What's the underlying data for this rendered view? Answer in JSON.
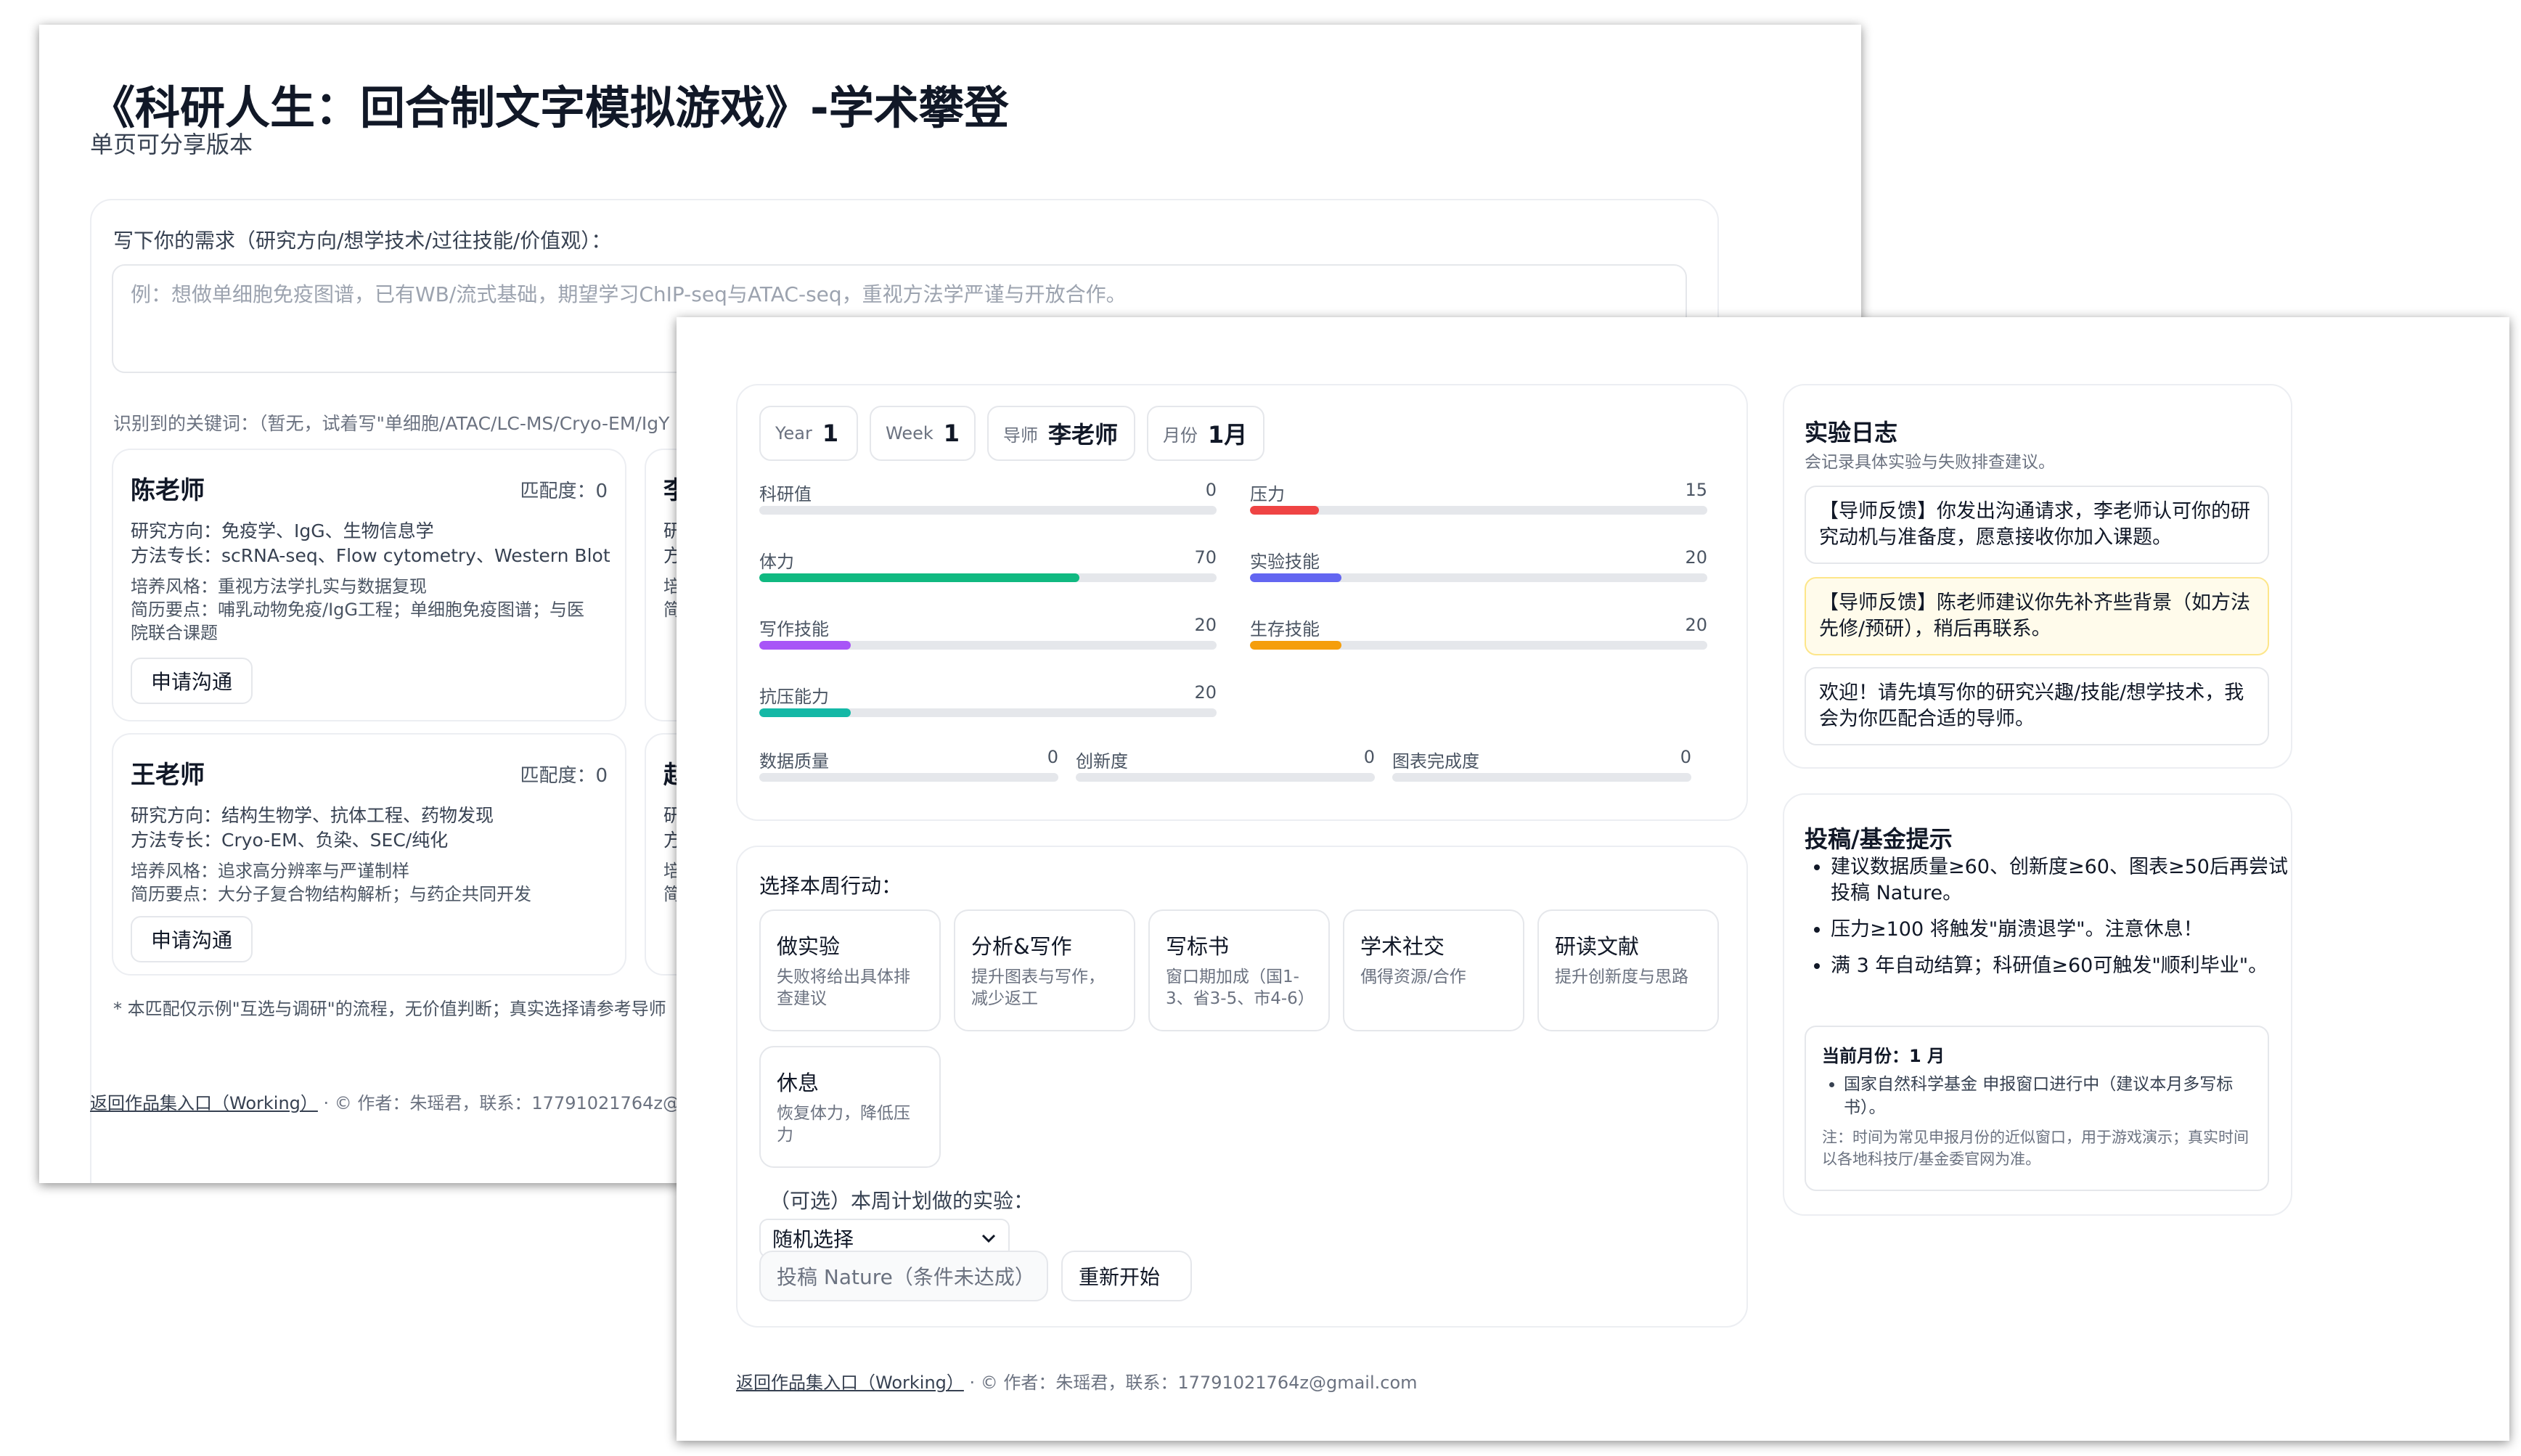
{
  "left_window": {
    "title": "《科研人生：回合制文字模拟游戏》-学术攀登",
    "subtitle": "单页可分享版本",
    "prompt_label": "写下你的需求（研究方向/想学技术/过往技能/价值观）：",
    "textarea_placeholder": "例：想做单细胞免疫图谱，已有WB/流式基础，期望学习ChIP-seq与ATAC-seq，重视方法学严谨与开放合作。",
    "keywords_line": "识别到的关键词：（暂无，试着写\"单细胞/ATAC/LC-MS/Cryo-EM/IgY",
    "mentors": [
      {
        "name": "陈老师",
        "match": "匹配度：0",
        "direction": "研究方向：免疫学、IgG、生物信息学",
        "methods": "方法专长：scRNA-seq、Flow cytometry、Western Blot",
        "style": "培养风格：重视方法学扎实与数据复现",
        "resume1": "简历要点：哺乳动物免疫/IgG工程；单细胞免疫图谱；与医",
        "resume2": "院联合课题",
        "button": "申请沟通"
      },
      {
        "name": "王老师",
        "match": "匹配度：0",
        "direction": "研究方向：结构生物学、抗体工程、药物发现",
        "methods": "方法专长：Cryo-EM、负染、SEC/纯化",
        "style": "培养风格：追求高分辨率与严谨制样",
        "resume1": "简历要点：大分子复合物结构解析；与药企共同开发",
        "button": "申请沟通"
      }
    ],
    "peek_cards": [
      {
        "name": "李",
        "l1": "研",
        "l2": "方",
        "l3": "培",
        "l4": "简"
      },
      {
        "name": "赵",
        "l1": "研",
        "l2": "方",
        "l3": "培",
        "l4": "简"
      }
    ],
    "note": "* 本匹配仅示例\"互选与调研\"的流程，无价值判断；真实选择请参考导师",
    "footer_link": "返回作品集入口（Working）",
    "footer_text": " · © 作者：朱瑶君，联系：17791021764z@"
  },
  "right_window": {
    "chips": [
      {
        "key": "Year",
        "value": "1"
      },
      {
        "key": "Week",
        "value": "1"
      },
      {
        "key": "导师",
        "value": "李老师"
      },
      {
        "key": "月份",
        "value": "1月"
      }
    ],
    "stats": [
      {
        "label": "科研值",
        "value": "0",
        "pct": 0,
        "color": "#9ca3af"
      },
      {
        "label": "压力",
        "value": "15",
        "pct": 15,
        "color": "#ef4444"
      },
      {
        "label": "体力",
        "value": "70",
        "pct": 70,
        "color": "#10b981"
      },
      {
        "label": "实验技能",
        "value": "20",
        "pct": 20,
        "color": "#6366f1"
      },
      {
        "label": "写作技能",
        "value": "20",
        "pct": 20,
        "color": "#a855f7"
      },
      {
        "label": "生存技能",
        "value": "20",
        "pct": 20,
        "color": "#f59e0b"
      },
      {
        "label": "抗压能力",
        "value": "20",
        "pct": 20,
        "color": "#14b8a6"
      }
    ],
    "quality_stats": [
      {
        "label": "数据质量",
        "value": "0",
        "pct": 0
      },
      {
        "label": "创新度",
        "value": "0",
        "pct": 0
      },
      {
        "label": "图表完成度",
        "value": "0",
        "pct": 0
      }
    ],
    "actions_title": "选择本周行动：",
    "actions": [
      {
        "title": "做实验",
        "desc": "失败将给出具体排查建议"
      },
      {
        "title": "分析&写作",
        "desc": "提升图表与写作，减少返工"
      },
      {
        "title": "写标书",
        "desc": "窗口期加成（国1-3、省3-5、市4-6）"
      },
      {
        "title": "学术社交",
        "desc": "偶得资源/合作"
      },
      {
        "title": "研读文献",
        "desc": "提升创新度与思路"
      },
      {
        "title": "休息",
        "desc": "恢复体力，降低压力"
      }
    ],
    "experiment_label": "（可选）本周计划做的实验：",
    "experiment_select": "随机选择",
    "submit_button": "投稿 Nature（条件未达成）",
    "restart_button": "重新开始",
    "log": {
      "title": "实验日志",
      "subtitle": "会记录具体实验与失败排查建议。",
      "entries": [
        "【导师反馈】你发出沟通请求，李老师认可你的研究动机与准备度，愿意接收你加入课题。",
        "【导师反馈】陈老师建议你先补齐些背景（如方法先修/预研），稍后再联系。",
        "欢迎！请先填写你的研究兴趣/技能/想学技术，我会为你匹配合适的导师。"
      ]
    },
    "tips": {
      "title": "投稿/基金提示",
      "items": [
        "建议数据质量≥60、创新度≥60、图表≥50后再尝试投稿 Nature。",
        "压力≥100 将触发\"崩溃退学\"。注意休息！",
        "满 3 年自动结算；科研值≥60可触发\"顺利毕业\"。"
      ],
      "month_title": "当前月份：1 月",
      "month_item": "国家自然科学基金 申报窗口进行中（建议本月多写标书）。",
      "month_note": "注：时间为常见申报月份的近似窗口，用于游戏演示；真实时间以各地科技厅/基金委官网为准。"
    },
    "footer_link": "返回作品集入口（Working）",
    "footer_text": " · © 作者：朱瑶君，联系：17791021764z@gmail.com"
  }
}
